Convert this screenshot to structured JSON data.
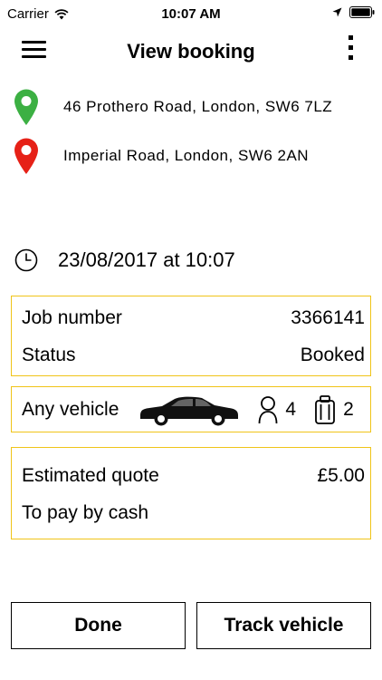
{
  "status_bar": {
    "carrier": "Carrier",
    "time": "10:07 AM"
  },
  "header": {
    "title": "View booking"
  },
  "pickup": {
    "address": "46 Prothero Road, London, SW6 7LZ",
    "pin_color": "#3cb043"
  },
  "dropoff": {
    "address": "Imperial Road, London, SW6 2AN",
    "pin_color": "#e62117"
  },
  "booking": {
    "datetime": "23/08/2017 at 10:07"
  },
  "job_card": {
    "job_number_label": "Job number",
    "job_number_value": "3366141",
    "status_label": "Status",
    "status_value": "Booked"
  },
  "vehicle_card": {
    "label": "Any vehicle",
    "passengers": "4",
    "luggage": "2"
  },
  "quote_card": {
    "quote_label": "Estimated quote",
    "quote_value": "£5.00",
    "payment_note": "To pay by cash"
  },
  "actions": {
    "done_label": "Done",
    "track_label": "Track vehicle"
  },
  "colors": {
    "accent_border": "#f0c419"
  }
}
